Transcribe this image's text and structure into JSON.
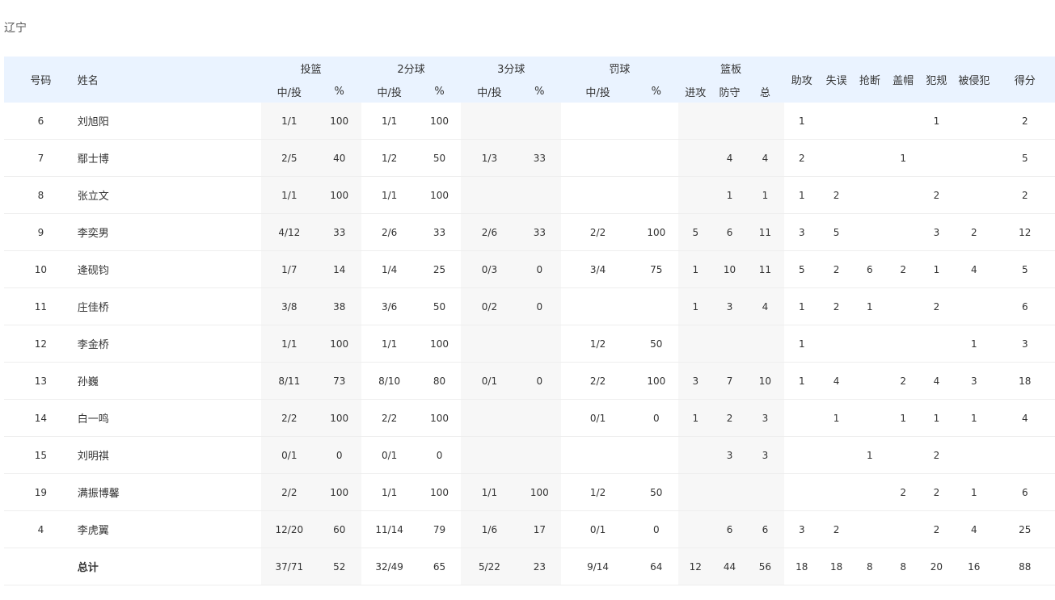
{
  "team": "辽宁",
  "headers": {
    "number": "号码",
    "name": "姓名",
    "fg": "投篮",
    "two": "2分球",
    "three": "3分球",
    "ft": "罚球",
    "reb": "篮板",
    "made_att": "中/投",
    "pct": "%",
    "off": "进攻",
    "def": "防守",
    "tot": "总",
    "ast": "助攻",
    "tov": "失误",
    "stl": "抢断",
    "blk": "盖帽",
    "pf": "犯规",
    "fd": "被侵犯",
    "pts": "得分"
  },
  "rows": [
    {
      "num": "6",
      "name": "刘旭阳",
      "fg": "1/1",
      "fgp": "100",
      "p2": "1/1",
      "p2p": "100",
      "p3": "",
      "p3p": "",
      "ft": "",
      "ftp": "",
      "oreb": "",
      "dreb": "",
      "reb": "",
      "ast": "1",
      "tov": "",
      "stl": "",
      "blk": "",
      "pf": "1",
      "fd": "",
      "pts": "2"
    },
    {
      "num": "7",
      "name": "鄢士博",
      "fg": "2/5",
      "fgp": "40",
      "p2": "1/2",
      "p2p": "50",
      "p3": "1/3",
      "p3p": "33",
      "ft": "",
      "ftp": "",
      "oreb": "",
      "dreb": "4",
      "reb": "4",
      "ast": "2",
      "tov": "",
      "stl": "",
      "blk": "1",
      "pf": "",
      "fd": "",
      "pts": "5"
    },
    {
      "num": "8",
      "name": "张立文",
      "fg": "1/1",
      "fgp": "100",
      "p2": "1/1",
      "p2p": "100",
      "p3": "",
      "p3p": "",
      "ft": "",
      "ftp": "",
      "oreb": "",
      "dreb": "1",
      "reb": "1",
      "ast": "1",
      "tov": "2",
      "stl": "",
      "blk": "",
      "pf": "2",
      "fd": "",
      "pts": "2"
    },
    {
      "num": "9",
      "name": "李奕男",
      "fg": "4/12",
      "fgp": "33",
      "p2": "2/6",
      "p2p": "33",
      "p3": "2/6",
      "p3p": "33",
      "ft": "2/2",
      "ftp": "100",
      "oreb": "5",
      "dreb": "6",
      "reb": "11",
      "ast": "3",
      "tov": "5",
      "stl": "",
      "blk": "",
      "pf": "3",
      "fd": "2",
      "pts": "12"
    },
    {
      "num": "10",
      "name": "逄砚钧",
      "fg": "1/7",
      "fgp": "14",
      "p2": "1/4",
      "p2p": "25",
      "p3": "0/3",
      "p3p": "0",
      "ft": "3/4",
      "ftp": "75",
      "oreb": "1",
      "dreb": "10",
      "reb": "11",
      "ast": "5",
      "tov": "2",
      "stl": "6",
      "blk": "2",
      "pf": "1",
      "fd": "4",
      "pts": "5"
    },
    {
      "num": "11",
      "name": "庄佳桥",
      "fg": "3/8",
      "fgp": "38",
      "p2": "3/6",
      "p2p": "50",
      "p3": "0/2",
      "p3p": "0",
      "ft": "",
      "ftp": "",
      "oreb": "1",
      "dreb": "3",
      "reb": "4",
      "ast": "1",
      "tov": "2",
      "stl": "1",
      "blk": "",
      "pf": "2",
      "fd": "",
      "pts": "6"
    },
    {
      "num": "12",
      "name": "李金桥",
      "fg": "1/1",
      "fgp": "100",
      "p2": "1/1",
      "p2p": "100",
      "p3": "",
      "p3p": "",
      "ft": "1/2",
      "ftp": "50",
      "oreb": "",
      "dreb": "",
      "reb": "",
      "ast": "1",
      "tov": "",
      "stl": "",
      "blk": "",
      "pf": "",
      "fd": "1",
      "pts": "3"
    },
    {
      "num": "13",
      "name": "孙巍",
      "fg": "8/11",
      "fgp": "73",
      "p2": "8/10",
      "p2p": "80",
      "p3": "0/1",
      "p3p": "0",
      "ft": "2/2",
      "ftp": "100",
      "oreb": "3",
      "dreb": "7",
      "reb": "10",
      "ast": "1",
      "tov": "4",
      "stl": "",
      "blk": "2",
      "pf": "4",
      "fd": "3",
      "pts": "18"
    },
    {
      "num": "14",
      "name": "白一鸣",
      "fg": "2/2",
      "fgp": "100",
      "p2": "2/2",
      "p2p": "100",
      "p3": "",
      "p3p": "",
      "ft": "0/1",
      "ftp": "0",
      "oreb": "1",
      "dreb": "2",
      "reb": "3",
      "ast": "",
      "tov": "1",
      "stl": "",
      "blk": "1",
      "pf": "1",
      "fd": "1",
      "pts": "4"
    },
    {
      "num": "15",
      "name": "刘明祺",
      "fg": "0/1",
      "fgp": "0",
      "p2": "0/1",
      "p2p": "0",
      "p3": "",
      "p3p": "",
      "ft": "",
      "ftp": "",
      "oreb": "",
      "dreb": "3",
      "reb": "3",
      "ast": "",
      "tov": "",
      "stl": "1",
      "blk": "",
      "pf": "2",
      "fd": "",
      "pts": ""
    },
    {
      "num": "19",
      "name": "满振博馨",
      "fg": "2/2",
      "fgp": "100",
      "p2": "1/1",
      "p2p": "100",
      "p3": "1/1",
      "p3p": "100",
      "ft": "1/2",
      "ftp": "50",
      "oreb": "",
      "dreb": "",
      "reb": "",
      "ast": "",
      "tov": "",
      "stl": "",
      "blk": "2",
      "pf": "2",
      "fd": "1",
      "pts": "6"
    },
    {
      "num": "4",
      "name": "李虎翼",
      "fg": "12/20",
      "fgp": "60",
      "p2": "11/14",
      "p2p": "79",
      "p3": "1/6",
      "p3p": "17",
      "ft": "0/1",
      "ftp": "0",
      "oreb": "",
      "dreb": "6",
      "reb": "6",
      "ast": "3",
      "tov": "2",
      "stl": "",
      "blk": "",
      "pf": "2",
      "fd": "4",
      "pts": "25"
    }
  ],
  "total": {
    "num": "",
    "name": "总计",
    "fg": "37/71",
    "fgp": "52",
    "p2": "32/49",
    "p2p": "65",
    "p3": "5/22",
    "p3p": "23",
    "ft": "9/14",
    "ftp": "64",
    "oreb": "12",
    "dreb": "44",
    "reb": "56",
    "ast": "18",
    "tov": "18",
    "stl": "8",
    "blk": "8",
    "pf": "20",
    "fd": "16",
    "pts": "88"
  }
}
